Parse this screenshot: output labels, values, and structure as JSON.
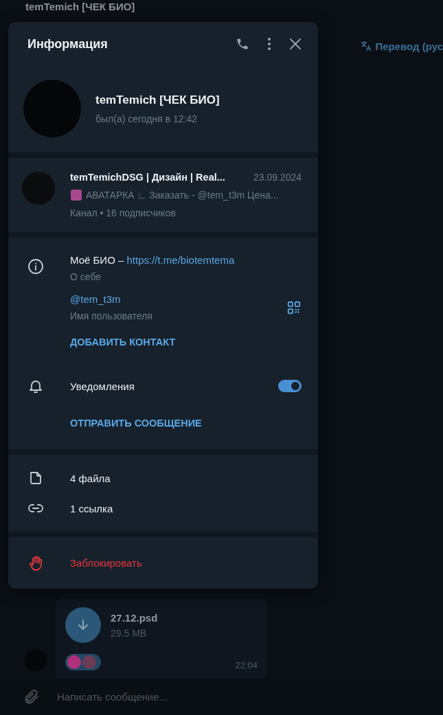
{
  "chat": {
    "title": "temTemich [ЧЕК БИО]",
    "translate": "Перевод (рус",
    "message": {
      "file_name": "27.12.psd",
      "file_size": "29.5 MB",
      "time": "22:04"
    },
    "composer": {
      "placeholder": "Написать сообщение..."
    }
  },
  "info_panel": {
    "title": "Информация",
    "profile": {
      "name": "temTemich [ЧЕК БИО]",
      "status": "был(а) сегодня в 12:42"
    },
    "channel": {
      "name": "temTemichDSG | Дизайн | Real...",
      "date": "23.09.2024",
      "preview": "АВАТАРКА ∟ Заказать - @tem_t3m  Цена...",
      "meta": "Канал • 16 подписчиков"
    },
    "bio": {
      "text": "Моё БИО –",
      "link": "https://t.me/biotemtema",
      "label": "О себе"
    },
    "username": {
      "value": "@tem_t3m",
      "label": "Имя пользователя"
    },
    "add_contact": "ДОБАВИТЬ КОНТАКТ",
    "notifications": {
      "label": "Уведомления",
      "on": true
    },
    "send_message": "ОТПРАВИТЬ СООБЩЕНИЕ",
    "media": [
      {
        "kind": "files",
        "label": "4 файла"
      },
      {
        "kind": "links",
        "label": "1 ссылка"
      }
    ],
    "block": "Заблокировать"
  }
}
